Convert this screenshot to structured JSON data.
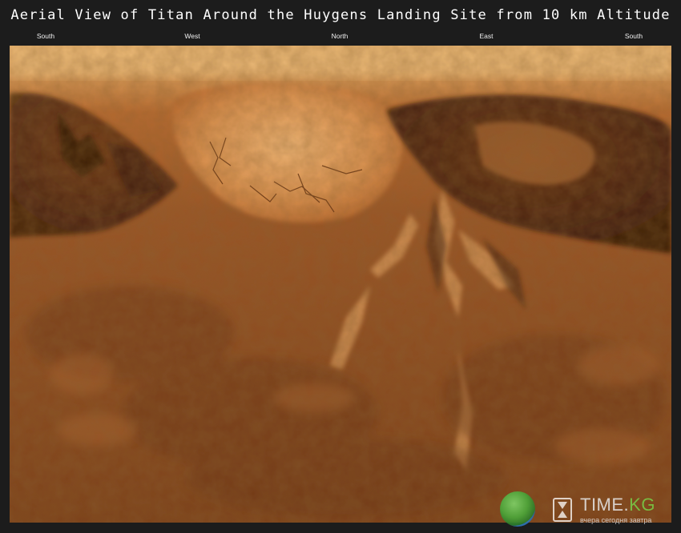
{
  "title": "Aerial View of Titan Around the Huygens Landing Site from 10 km Altitude",
  "directions": [
    "South",
    "West",
    "North",
    "East",
    "South"
  ],
  "panorama": {
    "icon": "titan-surface-panorama",
    "colors": {
      "sky": "#e8b06a",
      "highland": "#d4864a",
      "lowland": "#8a4a1e",
      "shadow": "#3a1a08"
    }
  },
  "watermark": {
    "brand_main": "TIME.",
    "brand_suffix": "KG",
    "tagline": "вчера сегодня завтра",
    "icons": [
      "globe-icon",
      "hourglass-icon"
    ]
  }
}
